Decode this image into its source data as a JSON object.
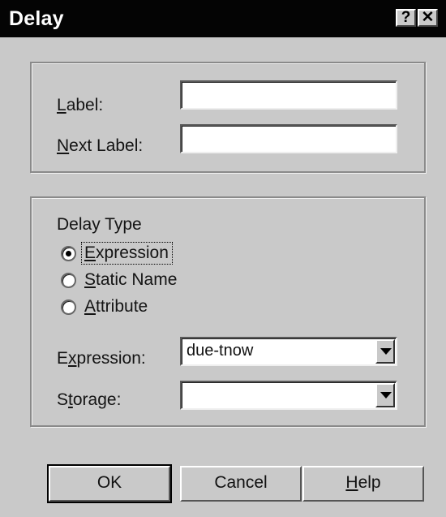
{
  "window": {
    "title": "Delay",
    "help_glyph": "?",
    "close_glyph": "✕"
  },
  "labels_group": {
    "label_field": {
      "label": "Label:",
      "value": ""
    },
    "next_label_field": {
      "label": "Next Label:",
      "value": ""
    }
  },
  "delay_group": {
    "delay_type_heading": "Delay Type",
    "options": [
      {
        "label": "Expression",
        "selected": true
      },
      {
        "label": "Static Name",
        "selected": false
      },
      {
        "label": "Attribute",
        "selected": false
      }
    ],
    "expression_combo": {
      "label": "Expression:",
      "value": "due-tnow"
    },
    "storage_combo": {
      "label": "Storage:",
      "value": ""
    }
  },
  "buttons": {
    "ok": "OK",
    "cancel": "Cancel",
    "help": "Help"
  }
}
